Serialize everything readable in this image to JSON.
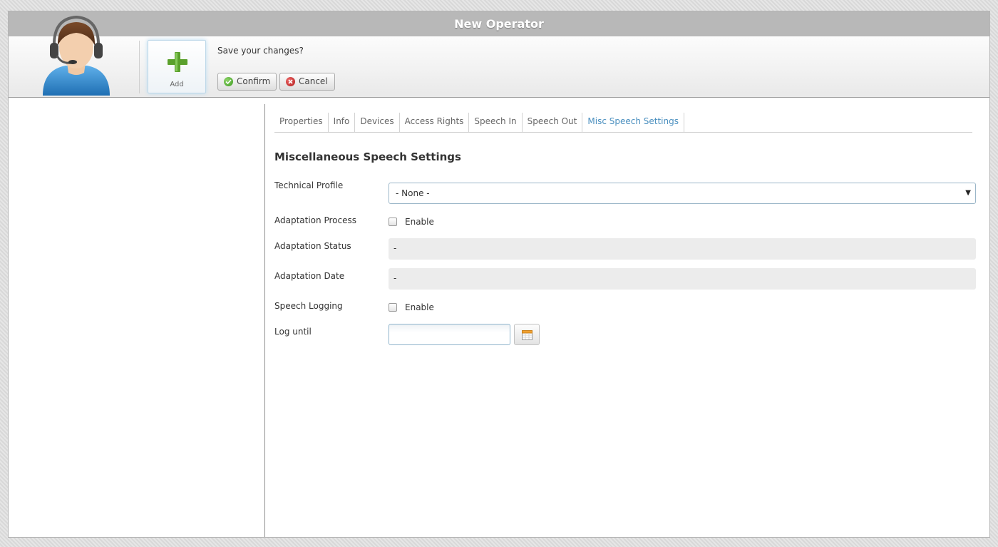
{
  "window": {
    "title": "New Operator"
  },
  "toolbar": {
    "add_label": "Add",
    "prompt": "Save your changes?",
    "confirm_label": "Confirm",
    "cancel_label": "Cancel"
  },
  "tabs": [
    {
      "label": "Properties",
      "active": false
    },
    {
      "label": "Info",
      "active": false
    },
    {
      "label": "Devices",
      "active": false
    },
    {
      "label": "Access Rights",
      "active": false
    },
    {
      "label": "Speech In",
      "active": false
    },
    {
      "label": "Speech Out",
      "active": false
    },
    {
      "label": "Misc Speech Settings",
      "active": true
    }
  ],
  "form": {
    "title": "Miscellaneous Speech Settings",
    "technical_profile": {
      "label": "Technical Profile",
      "value": "- None -"
    },
    "adaptation_process": {
      "label": "Adaptation Process",
      "checkbox_label": "Enable",
      "checked": false
    },
    "adaptation_status": {
      "label": "Adaptation Status",
      "value": "-"
    },
    "adaptation_date": {
      "label": "Adaptation Date",
      "value": "-"
    },
    "speech_logging": {
      "label": "Speech Logging",
      "checkbox_label": "Enable",
      "checked": false
    },
    "log_until": {
      "label": "Log until",
      "value": ""
    }
  },
  "icons": {
    "avatar": "operator-headset-avatar-icon",
    "add": "green-plus-icon",
    "confirm": "check-circle-icon",
    "cancel": "x-circle-icon",
    "calendar": "calendar-icon",
    "dropdown": "caret-down-icon"
  },
  "colors": {
    "titlebar": "#b8b8b8",
    "active_tab": "#4a8fbf",
    "add_plus": "#5aa02c"
  }
}
